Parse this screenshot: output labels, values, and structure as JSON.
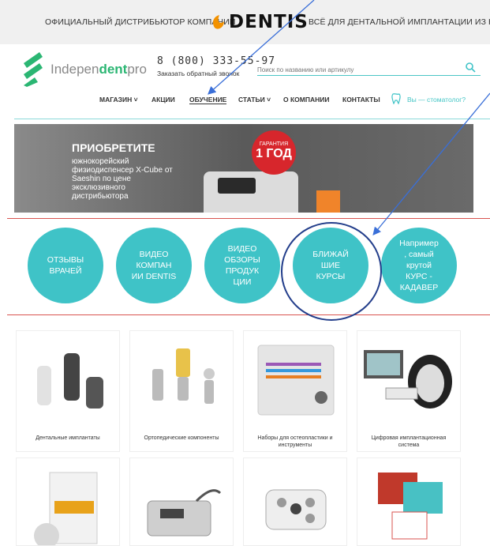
{
  "topbar": {
    "left_text": "ОФИЦИАЛЬНЫЙ ДИСТРИБЬЮТОР КОМПАНИИ",
    "brand": "DENTIS",
    "right_text": "ВСЁ ДЛЯ ДЕНТАЛЬНОЙ ИМПЛАНТАЦИИ ИЗ ЮЖНОЙ"
  },
  "header": {
    "logo_text_a": "Indepen",
    "logo_text_b": "dent",
    "logo_text_c": "pro",
    "phone": "8 (800) 333-55-97",
    "callback": "Заказать обратный звонок",
    "search_placeholder": "Поиск по названию или артикулу"
  },
  "nav": {
    "items": [
      "МАГАЗИН ˅",
      "АКЦИИ",
      "ОБУЧЕНИЕ",
      "СТАТЬИ ˅",
      "О КОМПАНИИ",
      "КОНТАКТЫ"
    ],
    "dentist": "Вы — стоматолог?"
  },
  "banner": {
    "heading": "ПРИОБРЕТИТЕ",
    "subtext": "южнокорейский физиодиспенсер X-Cube от Saeshin по цене эксклюзивного дистрибьютора",
    "badge_small": "ГАРАНТИЯ",
    "badge_big": "1 ГОД"
  },
  "circles": [
    "ОТЗЫВЫ\nВРАЧЕЙ",
    "ВИДЕО\nКОМПАН\nИИ DENTIS",
    "ВИДЕО\nОБЗОРЫ\nПРОДУК\nЦИИ",
    "БЛИЖАЙ\nШИЕ\nКУРСЫ",
    "Например\n, самый\nкрутой\nКУРС -\nКАДАВЕР"
  ],
  "products": [
    "Дентальные имплантаты",
    "Ортопедические компоненты",
    "Наборы для остеопластики и инструменты",
    "Цифровая имплантационная система"
  ],
  "colors": {
    "accent": "#3fc3c7",
    "brand_green": "#2bb673",
    "red_line": "#d9534f",
    "annotation": "#3a6fd8"
  }
}
